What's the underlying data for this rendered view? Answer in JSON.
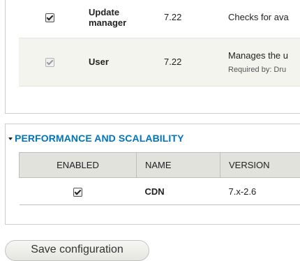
{
  "core_section": {
    "rows": [
      {
        "name": "Update manager",
        "name_line1": "Update",
        "name_line2": "manager",
        "version": "7.22",
        "description": "Checks for ava",
        "checked": true,
        "disabled": false
      },
      {
        "name": "User",
        "version": "7.22",
        "description": "Manages the u",
        "required_by": "Required by: Dru",
        "checked": true,
        "disabled": true
      }
    ]
  },
  "performance_section": {
    "title": "PERFORMANCE AND SCALABILITY",
    "columns": {
      "enabled": "ENABLED",
      "name": "NAME",
      "version": "VERSION"
    },
    "rows": [
      {
        "name": "CDN",
        "version": "7.x-2.6",
        "checked": true,
        "disabled": false
      }
    ]
  },
  "actions": {
    "save_label": "Save configuration"
  },
  "icons": {
    "collapse": "triangle-down-icon",
    "checkbox": "checkmark-icon"
  },
  "colors": {
    "legend": "#0074bd",
    "header_bg": "#e1e2dc",
    "row_alt_bg": "#f3f4ee"
  }
}
